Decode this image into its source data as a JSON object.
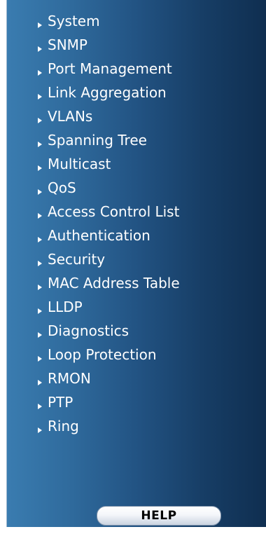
{
  "menu": {
    "items": [
      {
        "label": "System"
      },
      {
        "label": "SNMP"
      },
      {
        "label": "Port Management"
      },
      {
        "label": "Link Aggregation"
      },
      {
        "label": "VLANs"
      },
      {
        "label": "Spanning Tree"
      },
      {
        "label": "Multicast"
      },
      {
        "label": "QoS"
      },
      {
        "label": "Access Control List"
      },
      {
        "label": "Authentication"
      },
      {
        "label": "Security"
      },
      {
        "label": "MAC Address Table"
      },
      {
        "label": "LLDP"
      },
      {
        "label": "Diagnostics"
      },
      {
        "label": "Loop Protection"
      },
      {
        "label": "RMON"
      },
      {
        "label": "PTP"
      },
      {
        "label": "Ring"
      }
    ]
  },
  "help": {
    "label": "HELP"
  },
  "colors": {
    "panel_gradient_start": "#3a7cb0",
    "panel_gradient_end": "#0f2e50",
    "text": "#ffffff"
  },
  "icons": {
    "menu_arrow": "triangle-right-icon"
  }
}
